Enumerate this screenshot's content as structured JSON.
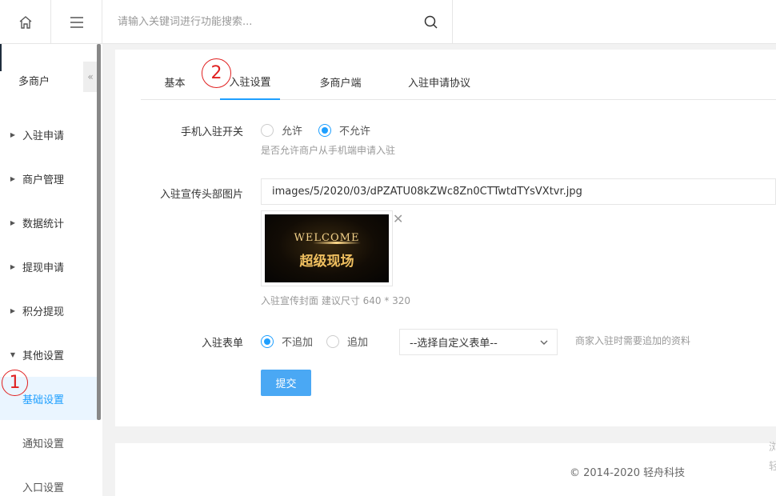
{
  "topbar": {
    "home_icon": "home-icon",
    "menu_icon": "hamburger-icon",
    "search_placeholder": "请输入关键词进行功能搜索...",
    "search_icon": "search-icon"
  },
  "sidebar": {
    "title": "多商户",
    "collapse_glyph": "«",
    "items": [
      {
        "label": "入驻申请",
        "arrow": "▶"
      },
      {
        "label": "商户管理",
        "arrow": "▶"
      },
      {
        "label": "数据统计",
        "arrow": "▶"
      },
      {
        "label": "提现申请",
        "arrow": "▶"
      },
      {
        "label": "积分提现",
        "arrow": "▶"
      },
      {
        "label": "其他设置",
        "arrow": "▼"
      }
    ],
    "subitems": [
      {
        "label": "基础设置",
        "active": true
      },
      {
        "label": "通知设置",
        "active": false
      },
      {
        "label": "入口设置",
        "active": false
      }
    ]
  },
  "annotations": {
    "marker1": "1",
    "marker2": "2"
  },
  "tabs": [
    {
      "label": "基本",
      "active": false
    },
    {
      "label": "入驻设置",
      "active": true
    },
    {
      "label": "多商户端",
      "active": false
    },
    {
      "label": "入驻申请协议",
      "active": false
    }
  ],
  "form": {
    "mobile_switch": {
      "label": "手机入驻开关",
      "options": [
        "允许",
        "不允许"
      ],
      "selected": "不允许",
      "help": "是否允许商户从手机端申请入驻"
    },
    "banner": {
      "label": "入驻宣传头部图片",
      "value": "images/5/2020/03/dPZATU08kZWc8Zn0CTTwtdTYsVXtvr.jpg",
      "thumb_text_top": "WELCOME",
      "thumb_text_main": "超级现场",
      "remove_glyph": "✕",
      "help": "入驻宣传封面 建议尺寸 640 * 320"
    },
    "entry_form": {
      "label": "入驻表单",
      "options": [
        "不追加",
        "追加"
      ],
      "selected": "不追加",
      "select_value": "--选择自定义表单--",
      "help": "商家入驻时需要追加的资料"
    },
    "submit_label": "提交"
  },
  "footer": {
    "copyright": "© 2014-2020 轻舟科技"
  },
  "edge_fragments": [
    "浏",
    "轻"
  ],
  "colors": {
    "accent": "#1e9fff",
    "submit": "#4aa8f4",
    "annotation": "#e02020"
  }
}
